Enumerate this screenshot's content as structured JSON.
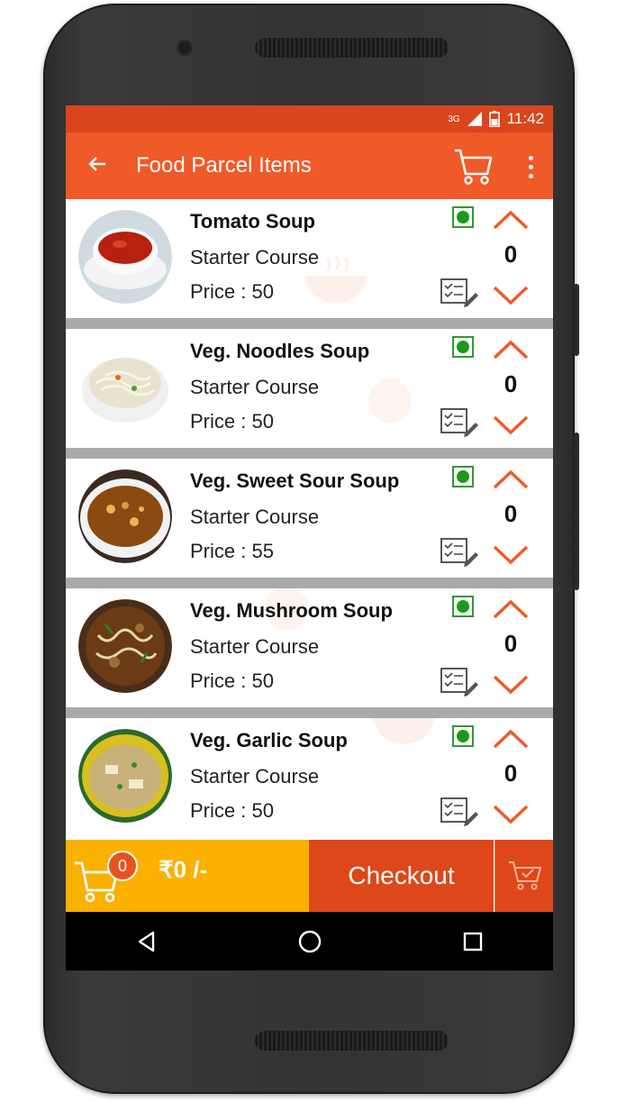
{
  "status_bar": {
    "network": "3G",
    "time": "11:42"
  },
  "app_bar": {
    "title": "Food Parcel Items",
    "back_icon": "arrow-left-icon",
    "cart_icon": "cart-icon",
    "menu_icon": "overflow-menu-icon"
  },
  "items": [
    {
      "name": "Tomato Soup",
      "course": "Starter Course",
      "price": "Price : 50",
      "qty": "0",
      "soup_color": "#b8200f"
    },
    {
      "name": "Veg. Noodles Soup",
      "course": "Starter Course",
      "price": "Price : 50",
      "qty": "0",
      "soup_color": "#e9e2cf"
    },
    {
      "name": "Veg. Sweet Sour Soup",
      "course": "Starter Course",
      "price": "Price : 55",
      "qty": "0",
      "soup_color": "#8a4a12"
    },
    {
      "name": "Veg. Mushroom Soup",
      "course": "Starter Course",
      "price": "Price : 50",
      "qty": "0",
      "soup_color": "#6b3b16"
    },
    {
      "name": "Veg. Garlic Soup",
      "course": "Starter Course",
      "price": "Price : 50",
      "qty": "0",
      "soup_color": "#c9b27a"
    }
  ],
  "bottom_bar": {
    "cart_count": "0",
    "total": "₹0 /-",
    "checkout_label": "Checkout"
  },
  "colors": {
    "primary": "#f05a28",
    "status": "#d9461b",
    "total_bg": "#fbb100",
    "checkout_bg": "#de4719",
    "veg": "#1a9a1a"
  }
}
